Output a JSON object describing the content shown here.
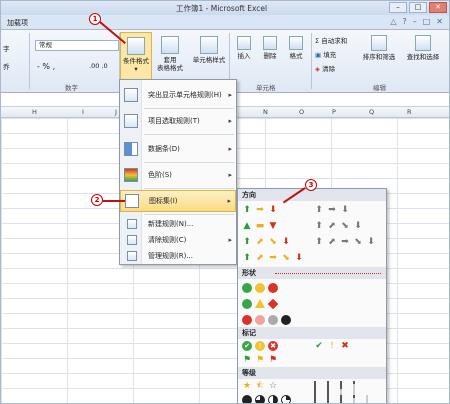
{
  "window": {
    "title": "工作簿1 - Microsoft Excel",
    "controls": [
      "–",
      "□",
      "✕"
    ]
  },
  "tabs": {
    "addins": "加载项",
    "right_icons": [
      "△",
      "?",
      "–",
      "□",
      "✕"
    ]
  },
  "ribbon": {
    "font_group_tail": "字",
    "align_group_tail": "乔",
    "number_format": "常规",
    "percent_row": "- % ,",
    "decimals": ".00 .0",
    "group_number": "数字",
    "conditional_format": "条件格式",
    "table_format": [
      "套用",
      "表格格式"
    ],
    "cell_style": "单元格样式",
    "insert": "插入",
    "delete": "删除",
    "format": "格式",
    "group_cells": "单元格",
    "autosum": "自动求和",
    "fill": "填充",
    "clear": "清除",
    "sort_filter": "排序和筛选",
    "find_select": "查找和选择",
    "group_edit": "编辑"
  },
  "columns": [
    "H",
    "I",
    "J",
    "K",
    "L",
    "M",
    "N",
    "O",
    "P",
    "Q",
    "R"
  ],
  "menu": {
    "items": [
      {
        "label": "突出显示单元格规则(H)",
        "arrow": "▸"
      },
      {
        "label": "项目选取规则(T)",
        "arrow": "▸"
      },
      {
        "label": "数据条(D)",
        "arrow": "▸"
      },
      {
        "label": "色阶(S)",
        "arrow": "▸"
      },
      {
        "label": "图标集(I)",
        "arrow": "▸"
      }
    ],
    "small_items": [
      "新建规则(N)...",
      "清除规则(C)",
      "管理规则(R)..."
    ],
    "small_arrow": "▸"
  },
  "submenu": {
    "sections": [
      "方向",
      "形状",
      "标记",
      "等级"
    ]
  },
  "callouts": [
    "1",
    "2",
    "3"
  ],
  "colors": {
    "highlight": "#fbdc84",
    "arrow_red": "#c01010"
  }
}
